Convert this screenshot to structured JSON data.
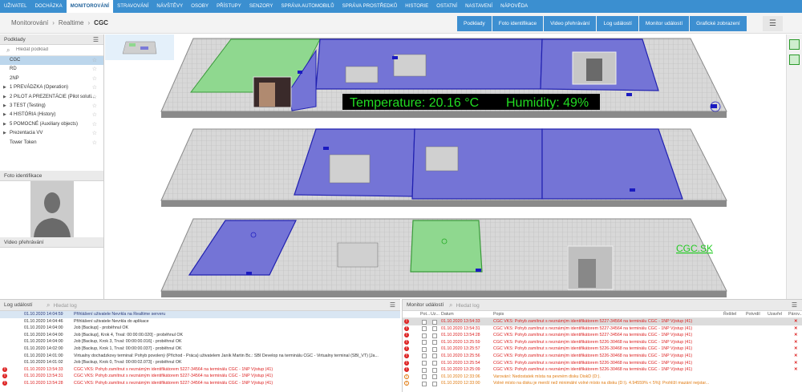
{
  "nav": {
    "items": [
      "UŽIVATEL",
      "DOCHÁZKA",
      "MONITOROVÁNÍ",
      "STRAVOVÁNÍ",
      "NÁVŠTĚVY",
      "OSOBY",
      "PŘÍSTUPY",
      "SENZORY",
      "SPRÁVA AUTOMOBILŮ",
      "SPRÁVA PROSTŘEDKŮ",
      "HISTORIE",
      "OSTATNÍ",
      "NASTAVENÍ",
      "NÁPOVĚDA"
    ],
    "active_index": 2
  },
  "breadcrumb": {
    "b1": "Monitorování",
    "b2": "Realtime",
    "b3": "CGC"
  },
  "actions": [
    "Podklady",
    "Foto identifikace",
    "Video přehrávání",
    "Log událostí",
    "Monitor událostí",
    "Grafické zobrazení"
  ],
  "podklady": {
    "title": "Podklady",
    "search_placeholder": "Hledat podklad",
    "items": [
      {
        "label": "CGC",
        "selected": true,
        "arrow": false
      },
      {
        "label": "RD",
        "selected": false,
        "arrow": false
      },
      {
        "label": "2NP",
        "selected": false,
        "arrow": false
      },
      {
        "label": "1 PREVÁDZKA (Operation)",
        "selected": false,
        "arrow": true
      },
      {
        "label": "2 PILOT A PREZENTÁCIE (Pilot soluti...",
        "selected": false,
        "arrow": true
      },
      {
        "label": "3 TEST (Testing)",
        "selected": false,
        "arrow": true
      },
      {
        "label": "4 HISTÓRIA (History)",
        "selected": false,
        "arrow": true
      },
      {
        "label": "5 POMOCNÉ (Auxiliary objects)",
        "selected": false,
        "arrow": true
      },
      {
        "label": "Prezentacia VV",
        "selected": false,
        "arrow": true
      },
      {
        "label": "Tower Token",
        "selected": false,
        "arrow": false
      }
    ]
  },
  "foto": {
    "title": "Foto identifikace"
  },
  "video": {
    "title": "Video přehrávání"
  },
  "map": {
    "temperature": "Temperature: 20.16 °C",
    "humidity": "Humidity: 49%",
    "label": "CGC.SK"
  },
  "log": {
    "title": "Log událostí",
    "search_placeholder": "Hledat log",
    "rows": [
      {
        "time": "01.10.2020 14:04:59",
        "msg": "Přihlášení uživatele Nevrkla na Realtime serveru",
        "type": "first"
      },
      {
        "time": "01.10.2020 14:04:46",
        "msg": "Přihlášení uživatele Nevrkla do aplikace",
        "type": "normal"
      },
      {
        "time": "01.10.2020 14:04:00",
        "msg": "Job [Backup] - proběhnul OK",
        "type": "normal"
      },
      {
        "time": "01.10.2020 14:04:00",
        "msg": "Job [Backup], Krok 4, Trval: 00:00:00.020] - proběhnul OK",
        "type": "normal"
      },
      {
        "time": "01.10.2020 14:04:00",
        "msg": "Job [Backup, Krok 3, Trval: 00:00:00.016] - proběhnul OK",
        "type": "normal"
      },
      {
        "time": "01.10.2020 14:02:00",
        "msg": "Job [Backup, Krok 1, Trval: 00:00:00.037] - proběhnul OK",
        "type": "normal"
      },
      {
        "time": "01.10.2020 14:01:00",
        "msg": "Virtualny dochadzkovy terminal: Pohyb povolený (Příchod - Práca) uživatelem Janík Martin Bc.: SBI Develop na terminálu CGC - Virtualny terminal (SBI_VT) [Ja...",
        "type": "normal"
      },
      {
        "time": "01.10.2020 14:01:02",
        "msg": "Job [Backup, Krok 0, Trval: 00:00:02.073] - proběhnul OK",
        "type": "normal"
      },
      {
        "time": "01.10.2020 13:54:33",
        "msg": "CGC VKS: Pohyb zamítnut s neznámým identifikátorem 5227-34564 na terminálu CGC - 1NP Výstup (41)",
        "type": "err"
      },
      {
        "time": "01.10.2020 13:54:31",
        "msg": "CGC VKS: Pohyb zamítnut s neznámým identifikátorem 5227-34564 na terminálu CGC - 1NP Výstup (41)",
        "type": "err"
      },
      {
        "time": "01.10.2020 13:54:28",
        "msg": "CGC VKS: Pohyb zamítnut s neznámým identifikátorem 5227-34564 na terminálu CGC - 1NP Výstup (41)",
        "type": "err"
      }
    ]
  },
  "monitor": {
    "title": "Monitor událostí",
    "search_placeholder": "Hledat log",
    "columns": {
      "pot": "Pot...",
      "uz": "Uz...",
      "datum": "Datum",
      "popis": "Popis",
      "resitel": "Řešitel",
      "potvrdil": "Potvrdil",
      "uzavrel": "Uzavřel",
      "parov": "Párov..."
    },
    "rows": [
      {
        "date": "01.10.2020 13:54:33",
        "desc": "CGC VKS: Pohyb zamítnut s neznámým identifikátorem 5227-34564 na terminálu CGC - 1NP Výstup (41)",
        "type": "err",
        "sel": true
      },
      {
        "date": "01.10.2020 13:54:31",
        "desc": "CGC VKS: Pohyb zamítnut s neznámým identifikátorem 5227-34564 na terminálu CGC - 1NP Výstup (41)",
        "type": "err",
        "sel": false
      },
      {
        "date": "01.10.2020 13:54:28",
        "desc": "CGC VKS: Pohyb zamítnut s neznámým identifikátorem 5227-34564 na terminálu CGC - 1NP Výstup (41)",
        "type": "err",
        "sel": false
      },
      {
        "date": "01.10.2020 13:25:59",
        "desc": "CGC VKS: Pohyb zamítnut s neznámým identifikátorem 5226-30468 na terminálu CGC - 1NP Výstup (41)",
        "type": "err",
        "sel": false
      },
      {
        "date": "01.10.2020 13:25:57",
        "desc": "CGC VKS: Pohyb zamítnut s neznámým identifikátorem 5226-30468 na terminálu CGC - 1NP Výstup (41)",
        "type": "err",
        "sel": false
      },
      {
        "date": "01.10.2020 13:25:56",
        "desc": "CGC VKS: Pohyb zamítnut s neznámým identifikátorem 5226-30468 na terminálu CGC - 1NP Výstup (41)",
        "type": "err",
        "sel": false
      },
      {
        "date": "01.10.2020 13:25:54",
        "desc": "CGC VKS: Pohyb zamítnut s neznámým identifikátorem 5226-30468 na terminálu CGC - 1NP Výstup (41)",
        "type": "err",
        "sel": false
      },
      {
        "date": "01.10.2020 13:25:09",
        "desc": "CGC VKS: Pohyb zamítnut s neznámým identifikátorem 5226-30468 na terminálu CGC - 1NP Výstup (41)",
        "type": "err",
        "sel": false
      },
      {
        "date": "01.10.2020 12:33:06",
        "desc": "Varování: Nedostatek místa na pevném disku DiskD (D:).",
        "type": "warn",
        "sel": false
      },
      {
        "date": "01.10.2020 12:33:00",
        "desc": "Volné místo na disku je menší než minimální volné místo na disku (D:\\). 4.94559% < 5%]: Prohlíží mazání nejstar...",
        "type": "warn",
        "sel": false
      }
    ]
  },
  "colors": {
    "nav": "#3b8fd0",
    "accent": "#3d8fd1",
    "zone_blue": "#6f6fd6",
    "zone_green": "#8fd88f",
    "error": "#dd2222",
    "warning": "#e07a10"
  }
}
